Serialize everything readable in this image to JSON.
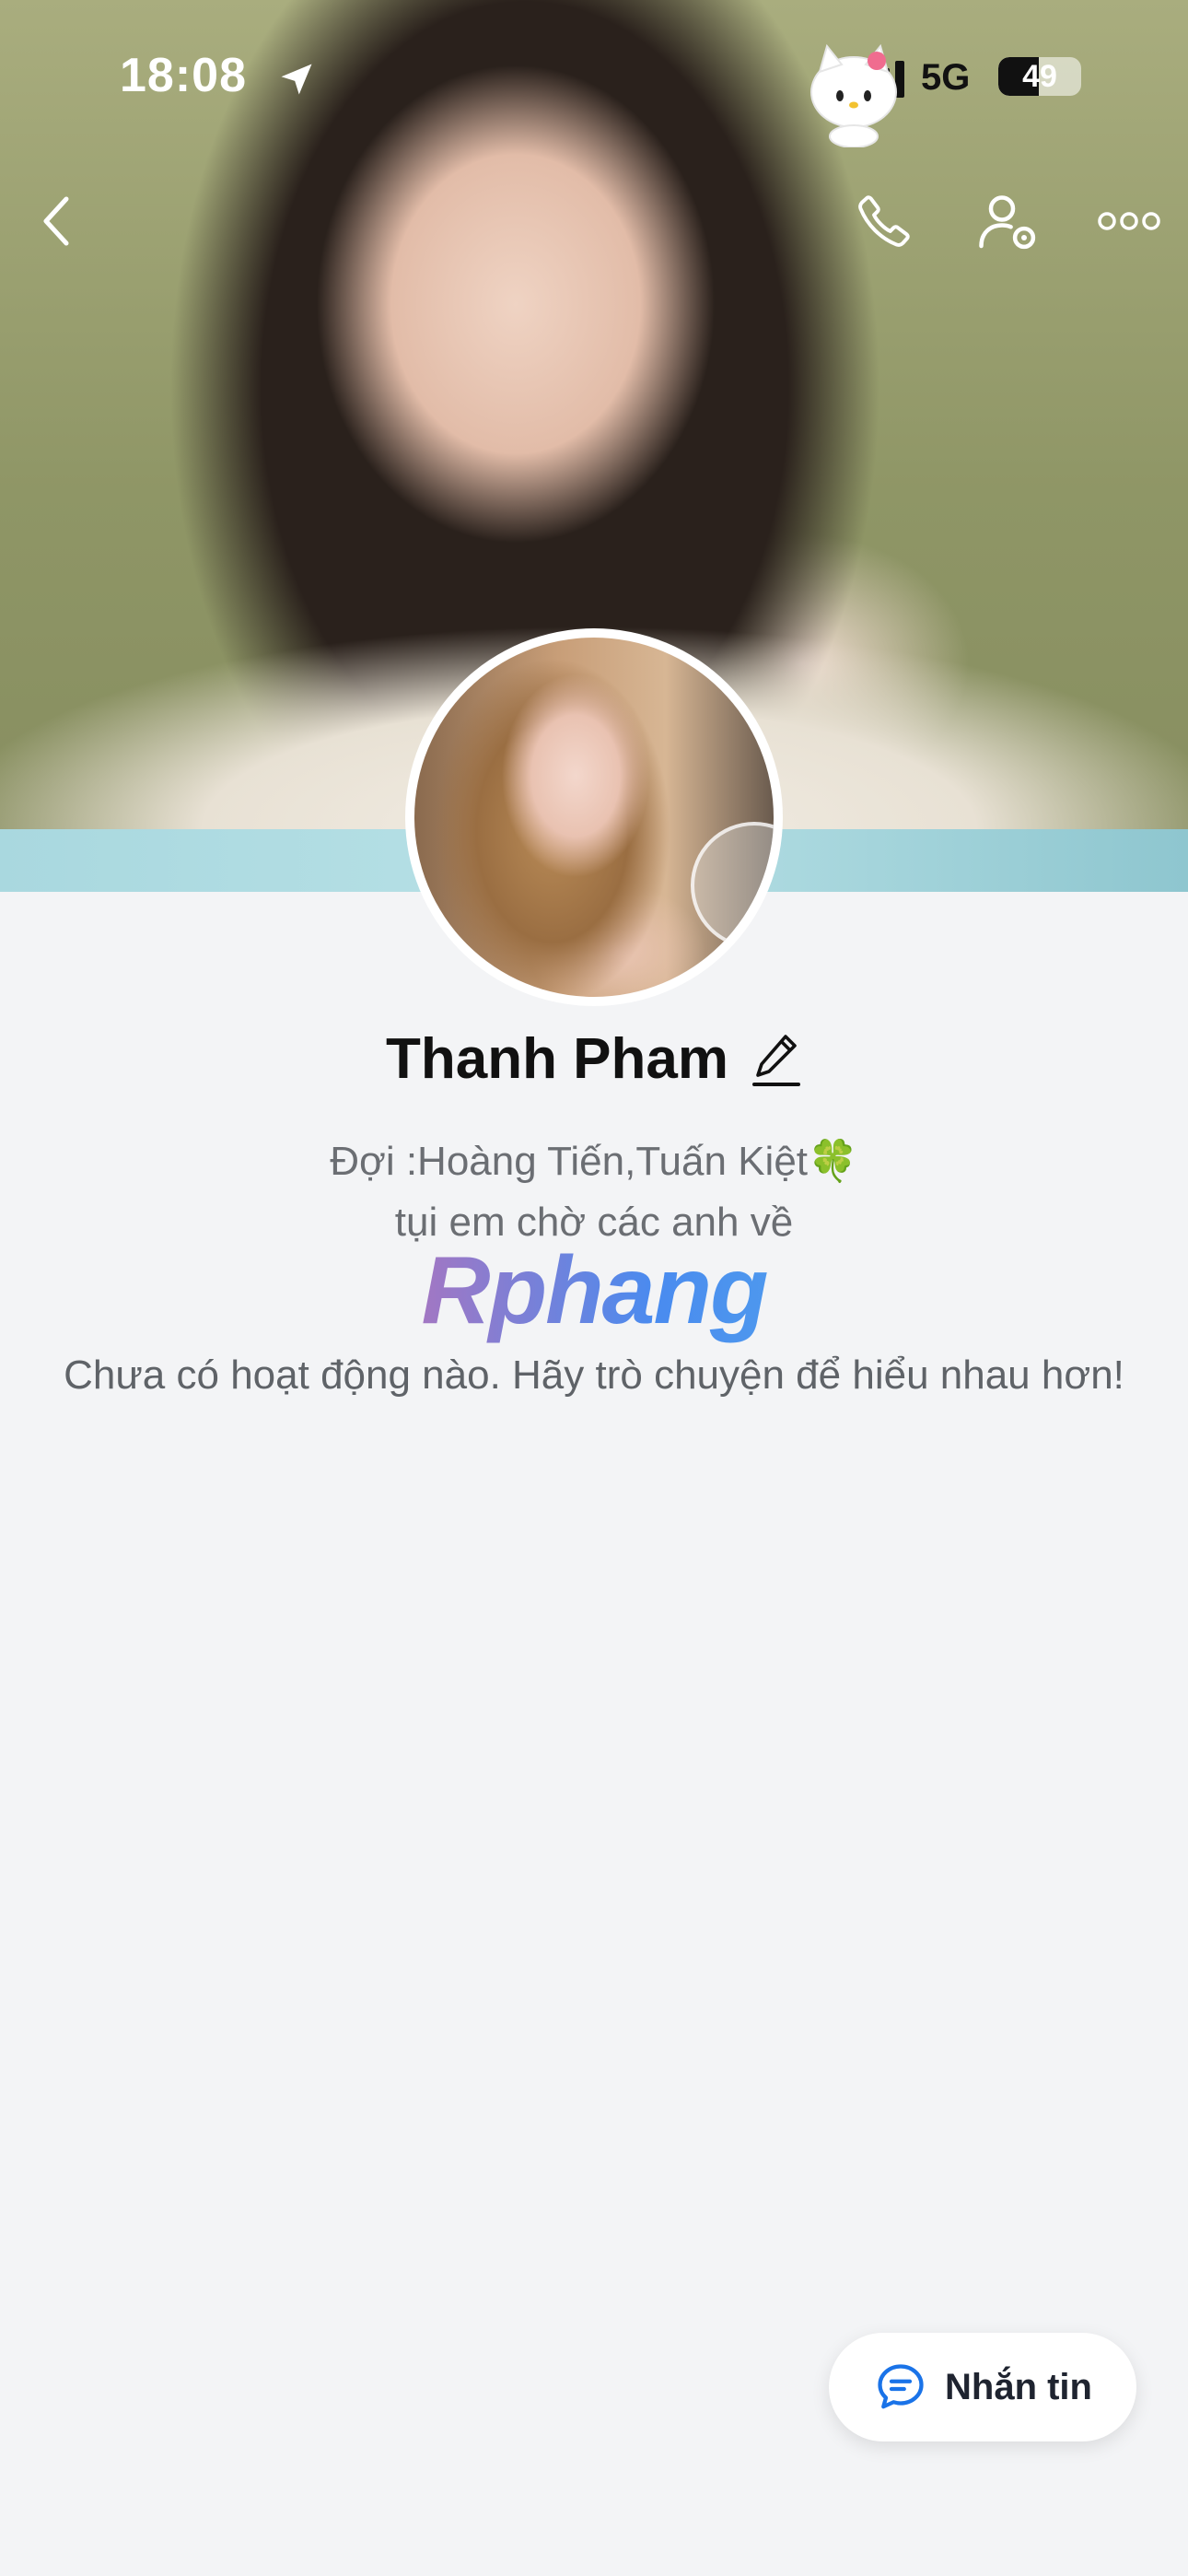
{
  "status_bar": {
    "time": "18:08",
    "network": "5G",
    "battery_level": "49",
    "battery_fraction": 0.49
  },
  "nav": {
    "icons": [
      "back-icon",
      "phone-icon",
      "user-settings-icon",
      "more-icon"
    ]
  },
  "profile": {
    "name": "Thanh Pham",
    "bio_line1": "Đợi :Hoàng Tiến,Tuấn Kiệt🍀",
    "bio_line2": "tụi em chờ các anh về",
    "brand": "Rphang",
    "empty_message": "Chưa có hoạt động nào. Hãy trò chuyện để hiểu nhau hơn!"
  },
  "actions": {
    "message_label": "Nhắn tin"
  },
  "colors": {
    "accent": "#1a73e8",
    "background": "#f3f4f6"
  }
}
